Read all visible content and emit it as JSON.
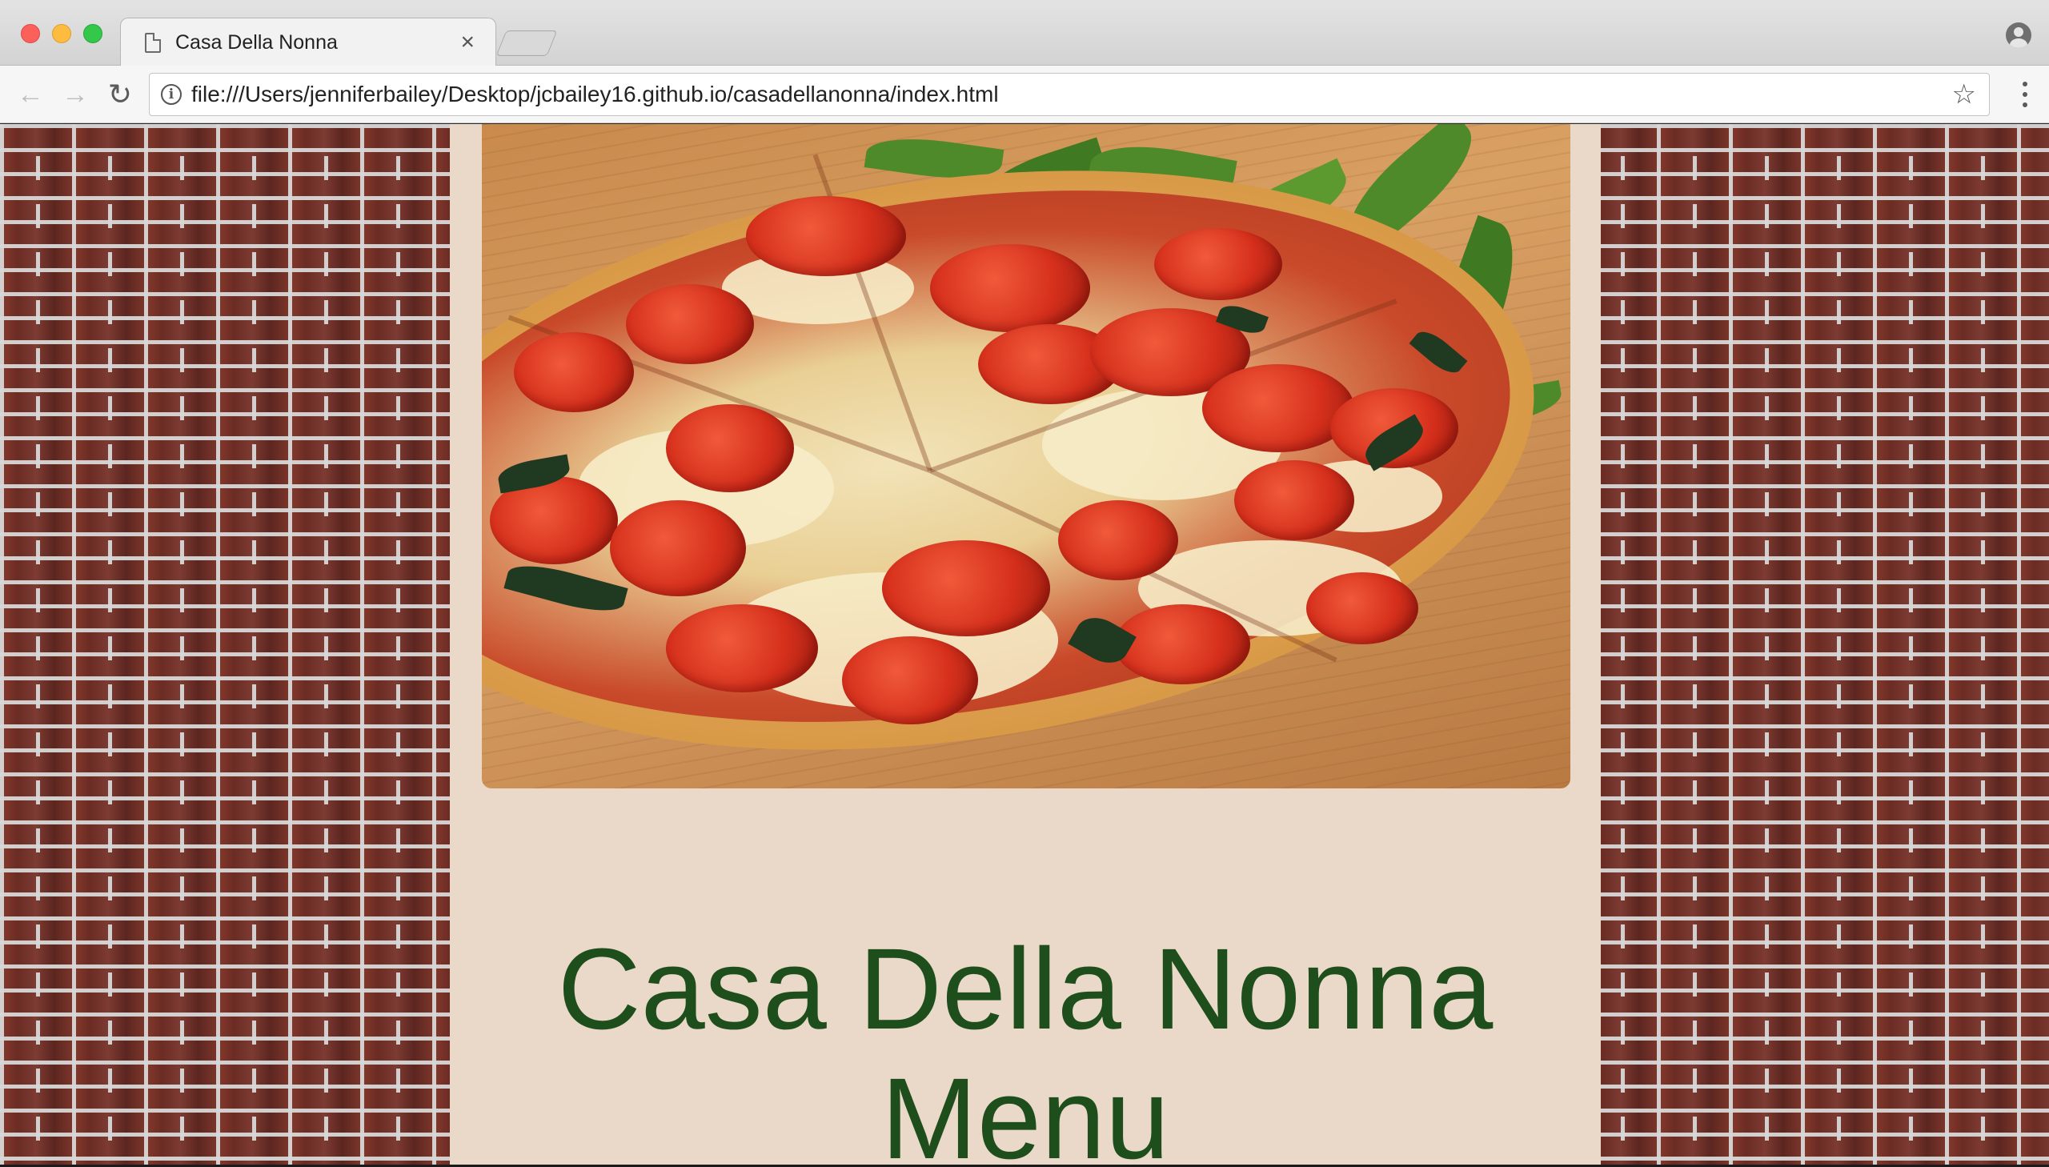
{
  "browser": {
    "tab": {
      "title": "Casa Della Nonna",
      "close_glyph": "×",
      "icon": "page-icon"
    },
    "toolbar": {
      "back_glyph": "←",
      "forward_glyph": "→",
      "reload_glyph": "↻",
      "info_glyph": "i",
      "url": "file:///Users/jenniferbailey/Desktop/jcbailey16.github.io/casadellanonna/index.html",
      "bookmark_glyph": "☆"
    },
    "colors": {
      "traffic_close": "#fc605b",
      "traffic_minimize": "#fdbc40",
      "traffic_maximize": "#34c84a"
    }
  },
  "page": {
    "hero_image": "pizza-photo",
    "heading_line1": "Casa Della Nonna",
    "heading_line2": "Menu",
    "colors": {
      "heading": "#1f4e1d",
      "content_background": "#ead9c8",
      "wall": "brick"
    }
  }
}
